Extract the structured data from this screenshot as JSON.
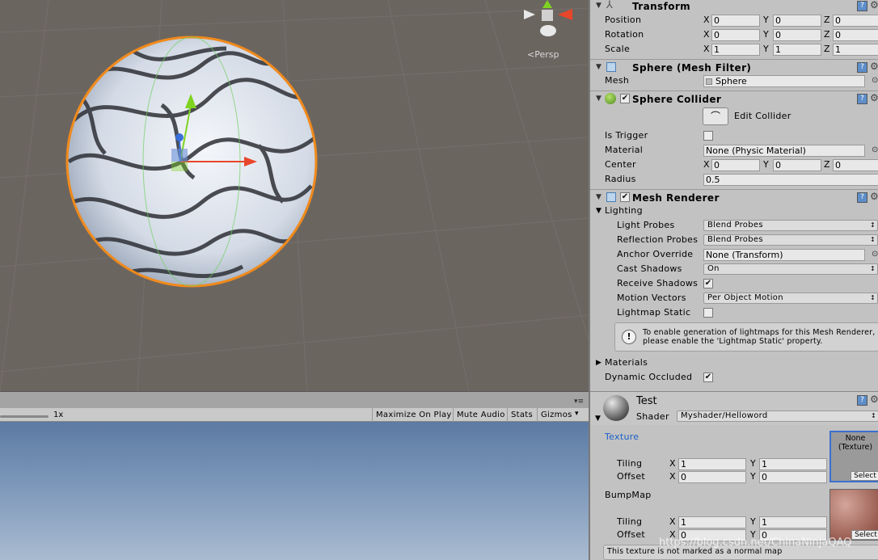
{
  "scene": {
    "persp_label": "Persp"
  },
  "game_toolbar": {
    "scale_value": "1x",
    "maximize_label": "Maximize On Play",
    "mute_label": "Mute Audio",
    "stats_label": "Stats",
    "gizmos_label": "Gizmos"
  },
  "transform": {
    "title": "Transform",
    "position_label": "Position",
    "rotation_label": "Rotation",
    "scale_label": "Scale",
    "position": {
      "x": "0",
      "y": "0",
      "z": "0"
    },
    "rotation": {
      "x": "0",
      "y": "0",
      "z": "0"
    },
    "scale": {
      "x": "1",
      "y": "1",
      "z": "1"
    },
    "axis_x": "X",
    "axis_y": "Y",
    "axis_z": "Z"
  },
  "mesh_filter": {
    "title": "Sphere (Mesh Filter)",
    "mesh_label": "Mesh",
    "mesh_value": "Sphere"
  },
  "sphere_collider": {
    "title": "Sphere Collider",
    "edit_label": "Edit Collider",
    "is_trigger_label": "Is Trigger",
    "material_label": "Material",
    "material_value": "None (Physic Material)",
    "center_label": "Center",
    "center": {
      "x": "0",
      "y": "0",
      "z": "0"
    },
    "radius_label": "Radius",
    "radius_value": "0.5"
  },
  "mesh_renderer": {
    "title": "Mesh Renderer",
    "lighting_label": "Lighting",
    "light_probes_label": "Light Probes",
    "light_probes_value": "Blend Probes",
    "reflection_probes_label": "Reflection Probes",
    "reflection_probes_value": "Blend Probes",
    "anchor_label": "Anchor Override",
    "anchor_value": "None (Transform)",
    "cast_shadows_label": "Cast Shadows",
    "cast_shadows_value": "On",
    "receive_shadows_label": "Receive Shadows",
    "motion_vectors_label": "Motion Vectors",
    "motion_vectors_value": "Per Object Motion",
    "lightmap_static_label": "Lightmap Static",
    "info_line1": "To enable generation of lightmaps for this Mesh Renderer,",
    "info_line2": "please enable the 'Lightmap Static' property.",
    "materials_label": "Materials",
    "dynamic_occluded_label": "Dynamic Occluded"
  },
  "material": {
    "name": "Test",
    "shader_label": "Shader",
    "shader_value": "Myshader/Helloword",
    "texture_label": "Texture",
    "texture_slot_line1": "None",
    "texture_slot_line2": "(Texture)",
    "select_label": "Select",
    "tiling_label": "Tiling",
    "offset_label": "Offset",
    "tex_tiling": {
      "x": "1",
      "y": "1"
    },
    "tex_offset": {
      "x": "0",
      "y": "0"
    },
    "bumpmap_label": "BumpMap",
    "bump_tiling": {
      "x": "1",
      "y": "1"
    },
    "bump_offset": {
      "x": "0",
      "y": "0"
    },
    "normal_warning": "This texture is not marked as a normal map"
  },
  "watermark": "https://blog.csdn.net/ChinaNinjaQAQ",
  "colors": {
    "scene_bg": "#6b6560",
    "selection_outline": "#f08a1c",
    "texture_label": "#1c5fc8"
  }
}
